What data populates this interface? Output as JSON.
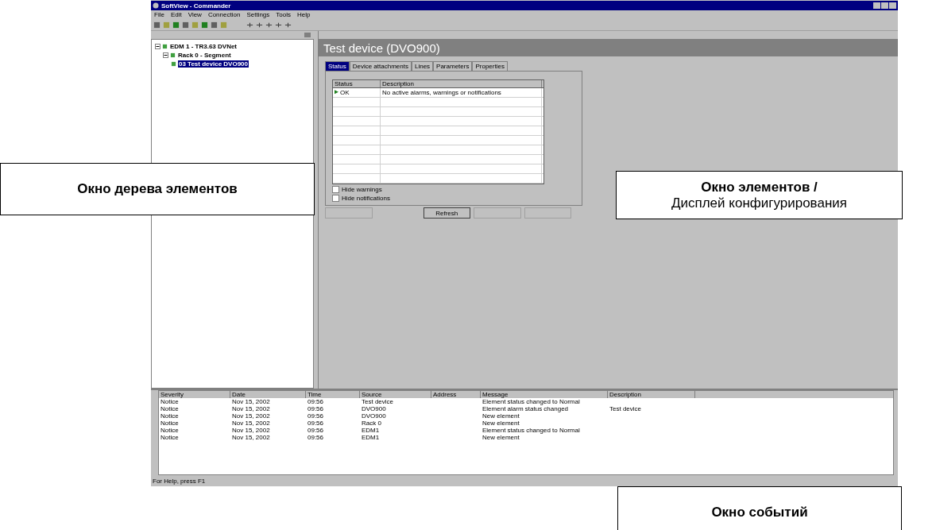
{
  "window": {
    "title": "SoftView - Commander"
  },
  "menu": [
    "File",
    "Edit",
    "View",
    "Connection",
    "Settings",
    "Tools",
    "Help"
  ],
  "tree": [
    {
      "label": "EDM 1 - TR3.63 DVNet",
      "expanded": true,
      "selected": false,
      "children": [
        {
          "label": "Rack 0 - Segment",
          "expanded": true,
          "selected": false,
          "children": [
            {
              "label": "03 Test device DVO900",
              "selected": true
            }
          ]
        }
      ]
    }
  ],
  "element": {
    "title": "Test device (DVO900)",
    "tabs": [
      {
        "label": "Status",
        "selected": true
      },
      {
        "label": "Device attachments",
        "selected": false
      },
      {
        "label": "Lines",
        "selected": false
      },
      {
        "label": "Parameters",
        "selected": false
      },
      {
        "label": "Properties",
        "selected": false
      }
    ],
    "columns": [
      "Status",
      "Description"
    ],
    "rows": [
      {
        "status": "OK",
        "description": "No active alarms, warnings or notifications"
      }
    ],
    "checkboxes": [
      {
        "label": "Hide warnings",
        "checked": false
      },
      {
        "label": "Hide notifications",
        "checked": false
      }
    ],
    "buttons": [
      {
        "disabled": true
      },
      {
        "label": "Refresh",
        "disabled": false
      },
      {
        "disabled": true
      },
      {
        "disabled": true
      }
    ]
  },
  "events": {
    "columns": [
      "Severity",
      "Date",
      "Time",
      "Source",
      "Address",
      "Message",
      "Description"
    ],
    "rows": [
      {
        "severity": "Notice",
        "date": "Nov 15, 2002",
        "time": "09:56",
        "source": "Test device",
        "message": "Element status changed to Normal"
      },
      {
        "severity": "Notice",
        "date": "Nov 15, 2002",
        "time": "09:56",
        "source": "DVO900",
        "message": "Element alarm status changed",
        "description": "Test device"
      },
      {
        "severity": "Notice",
        "date": "Nov 15, 2002",
        "time": "09:56",
        "source": "DVO900",
        "message": "New element"
      },
      {
        "severity": "Notice",
        "date": "Nov 15, 2002",
        "time": "09:56",
        "source": "Rack 0",
        "message": "New element"
      },
      {
        "severity": "Notice",
        "date": "Nov 15, 2002",
        "time": "09:56",
        "source": "EDM1",
        "message": "Element status changed to Normal"
      },
      {
        "severity": "Notice",
        "date": "Nov 15, 2002",
        "time": "09:56",
        "source": "EDM1",
        "message": "New element"
      }
    ]
  },
  "status_bar": "For Help, press F1",
  "callouts": [
    {
      "kind": "tree",
      "title": "Окно дерева элементов"
    },
    {
      "kind": "elements",
      "title": "Окно элементов /",
      "subtitle": "Дисплей конфигурирования"
    },
    {
      "kind": "events",
      "title": "Окно событий"
    }
  ]
}
